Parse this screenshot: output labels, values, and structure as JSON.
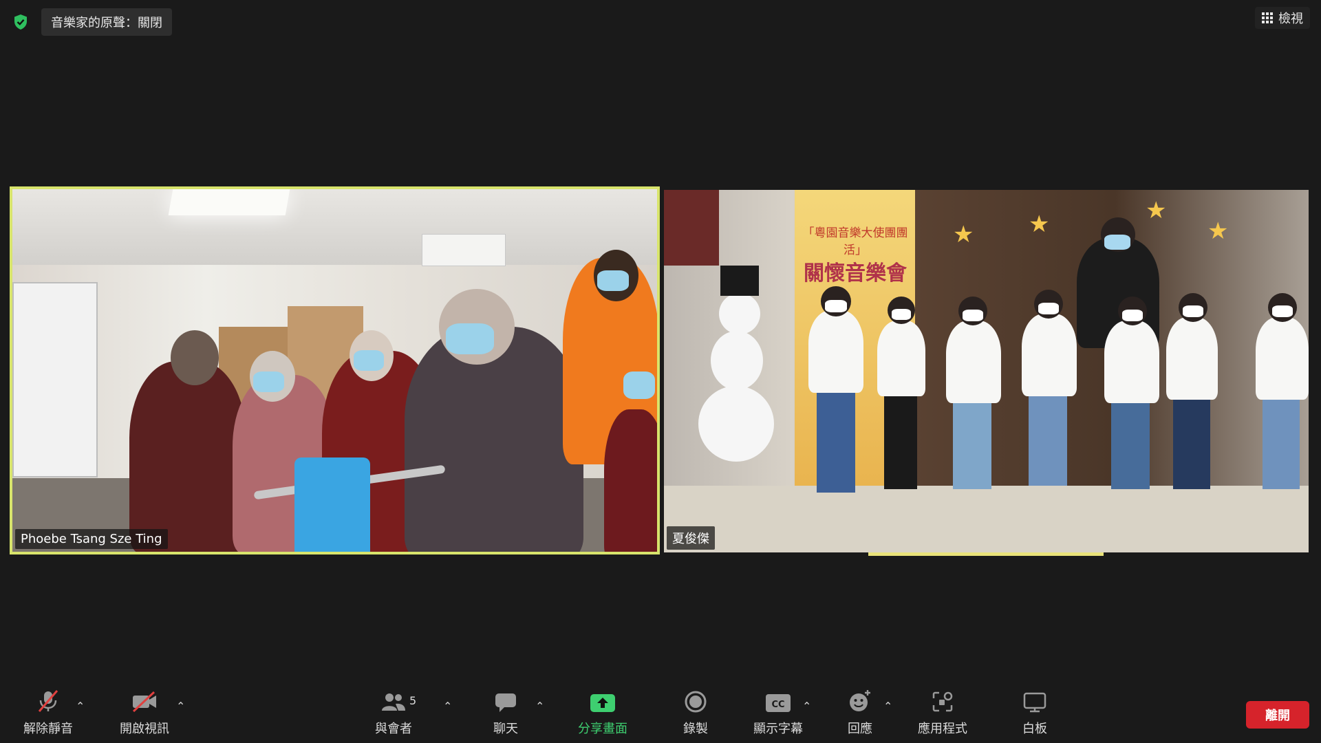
{
  "top": {
    "original_sound": "音樂家的原聲：關閉",
    "view_label": "檢視"
  },
  "participants": [
    {
      "name": "Phoebe Tsang Sze Ting",
      "active_speaker": true
    },
    {
      "name": "夏俊傑",
      "active_speaker": false
    }
  ],
  "scene_text": {
    "banner_line1": "「粵園音樂大使團團活」",
    "banner_line2": "關懷音樂會"
  },
  "toolbar": {
    "unmute": "解除靜音",
    "start_video": "開啟視訊",
    "participants": "與會者",
    "participant_count": "5",
    "chat": "聊天",
    "share": "分享畫面",
    "record": "錄製",
    "captions": "顯示字幕",
    "reactions": "回應",
    "apps": "應用程式",
    "whiteboard": "白板",
    "leave": "離開"
  },
  "colors": {
    "active_border": "#d8e46c",
    "share_green": "#3ecf70",
    "leave_red": "#d6232b",
    "mute_red": "#e0403f"
  }
}
